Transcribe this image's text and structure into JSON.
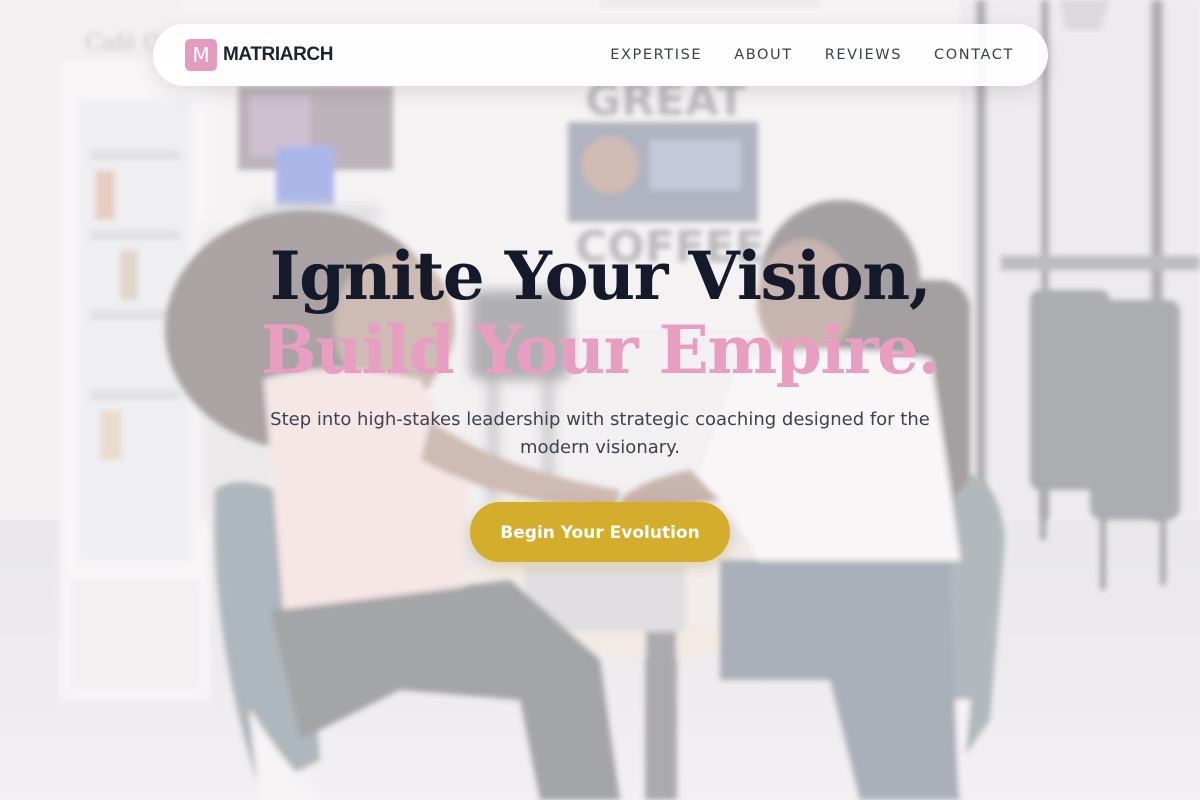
{
  "brand": {
    "mark": "M",
    "name": "MATRIARCH"
  },
  "nav": {
    "links": [
      "EXPERTISE",
      "ABOUT",
      "REVIEWS",
      "CONTACT"
    ]
  },
  "hero": {
    "headline_line1": "Ignite Your Vision,",
    "headline_line2": "Build Your Empire.",
    "subtitle": "Step into high-stakes leadership with strategic coaching designed for the modern visionary.",
    "cta_label": "Begin Your Evolution"
  },
  "background_signage": {
    "wall_top": "GREAT",
    "wall_bottom": "COFFEE",
    "fridge_logo": "Café One"
  },
  "colors": {
    "accent_pink": "#e89ec0",
    "brand_mark_pink": "#e49bbd",
    "cta_gold": "#d5ad2c",
    "headline_navy": "#151a2b"
  }
}
